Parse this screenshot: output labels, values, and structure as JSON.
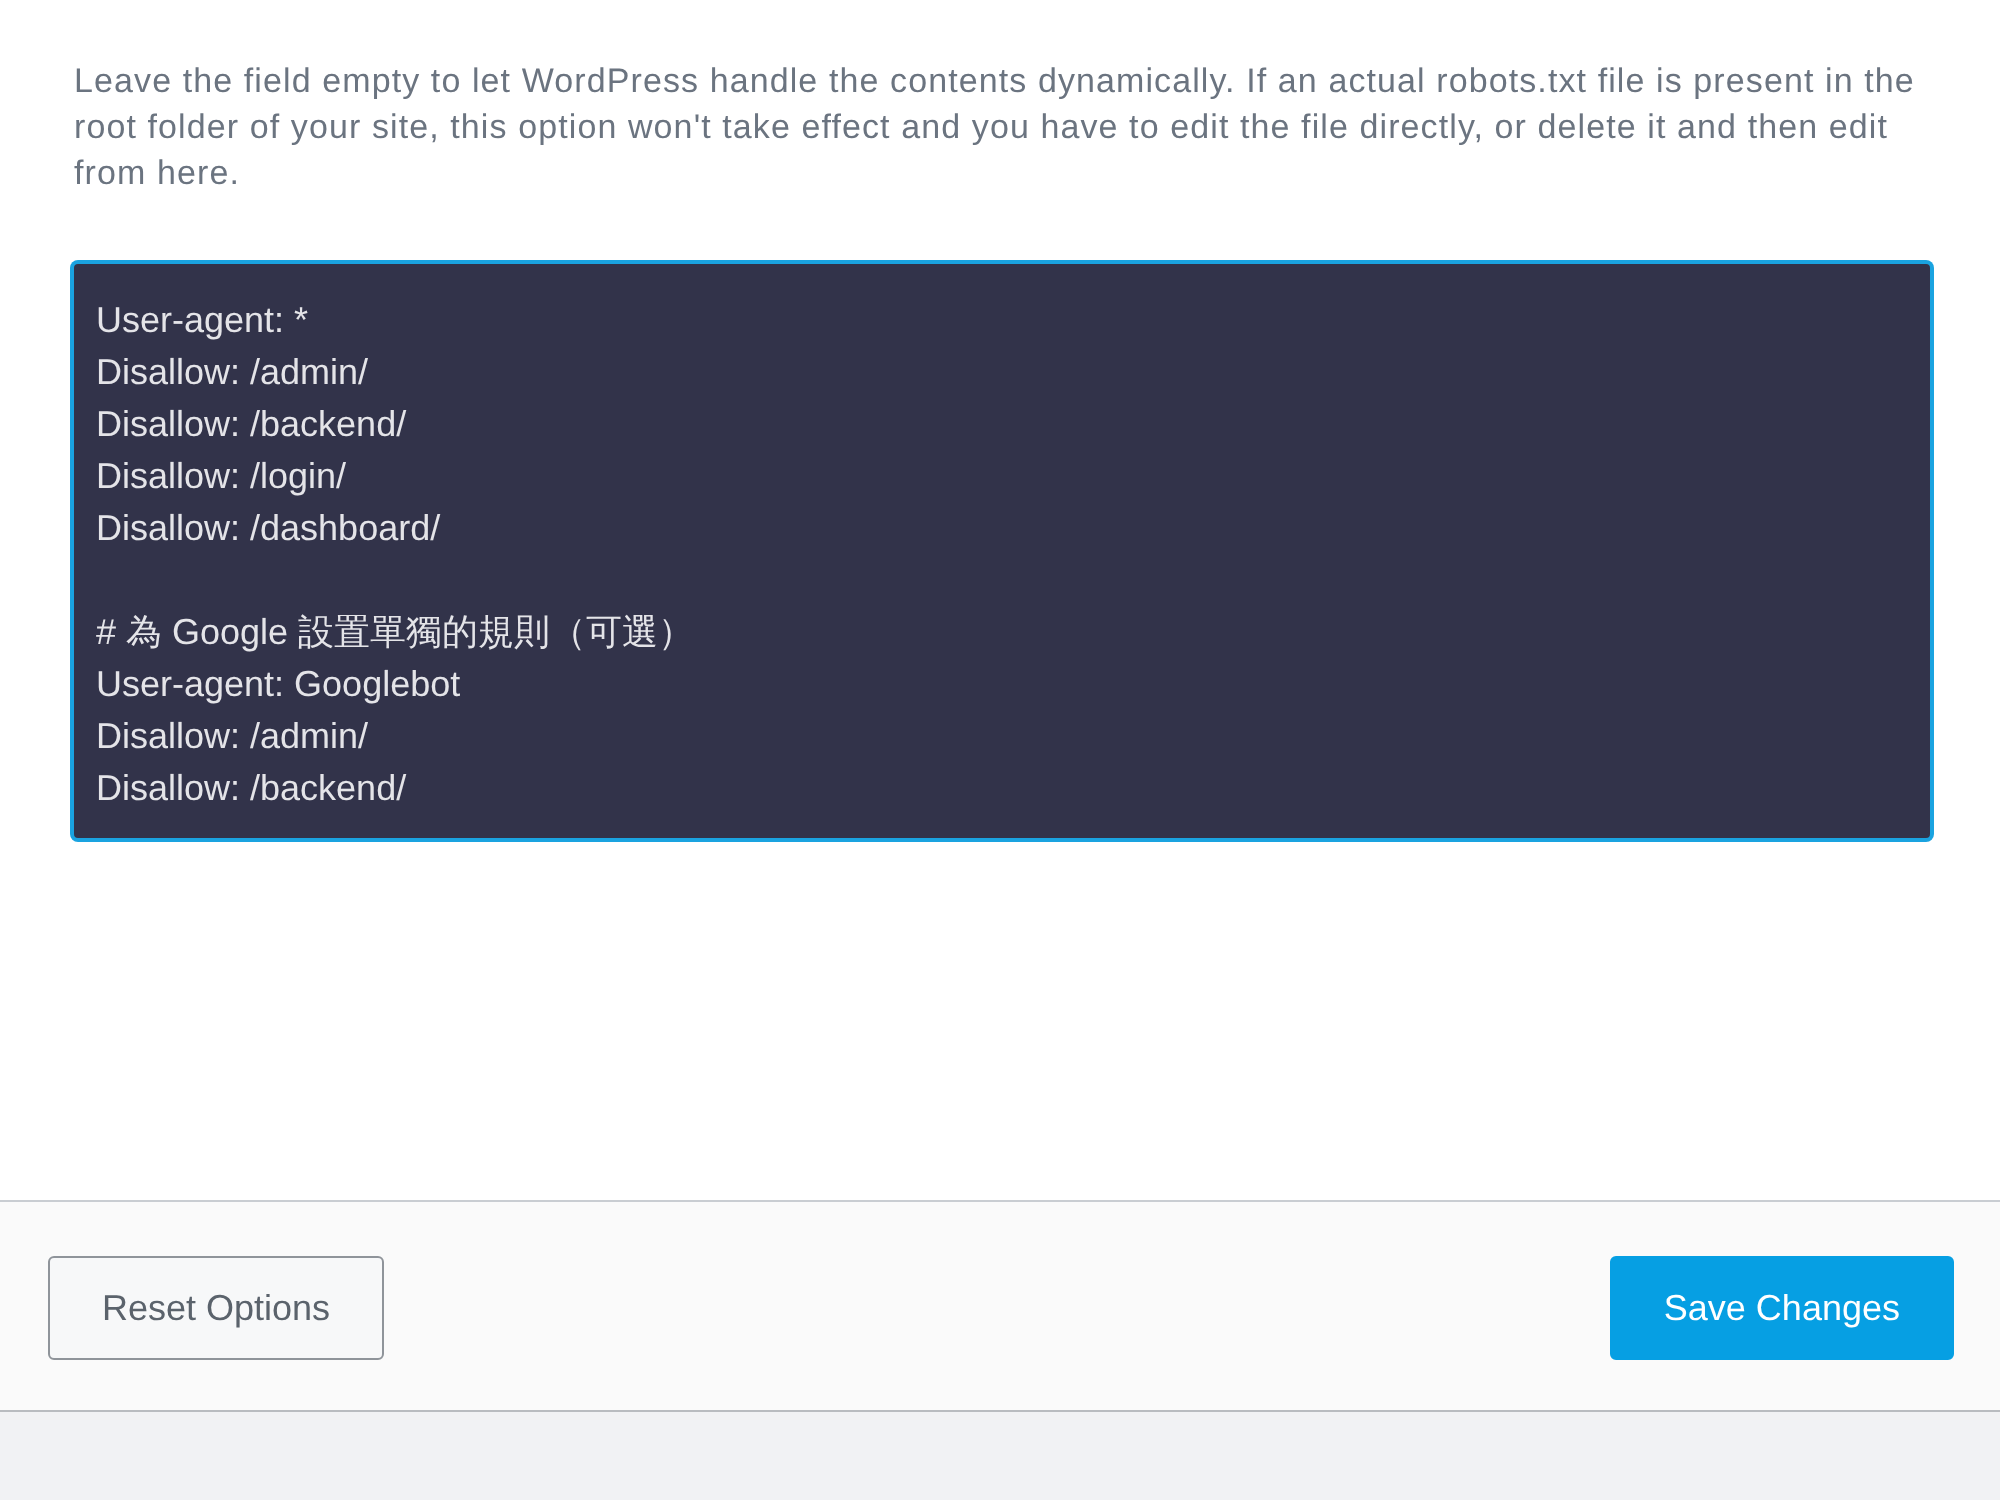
{
  "description": "Leave the field empty to let WordPress handle the contents dynamically. If an actual robots.txt file is present in the root folder of your site, this option won't take effect and you have to edit the file directly, or delete it and then edit from here.",
  "editor": {
    "focused": true,
    "value": "User-agent: *\nDisallow: /admin/\nDisallow: /backend/\nDisallow: /login/\nDisallow: /dashboard/\n\n# 為 Google 設置單獨的規則（可選）\nUser-agent: Googlebot\nDisallow: /admin/\nDisallow: /backend/"
  },
  "buttons": [
    {
      "label": "Reset Options",
      "kind": "secondary"
    },
    {
      "label": "Save Changes",
      "kind": "primary"
    }
  ]
}
